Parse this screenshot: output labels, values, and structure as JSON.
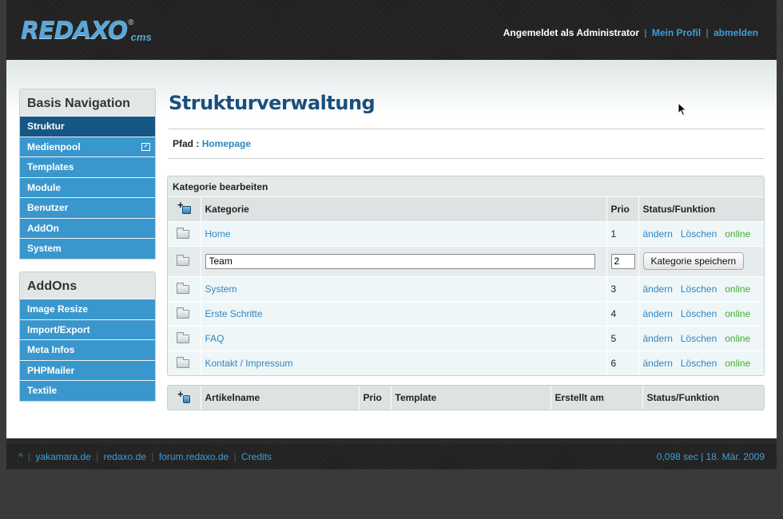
{
  "header": {
    "logo_text": "REDAXO",
    "logo_reg": "®",
    "logo_suffix": "cms",
    "logged_in_text": "Angemeldet als Administrator",
    "separator": "|",
    "profile_link": "Mein Profil",
    "logout_link": "abmelden"
  },
  "sidebar": {
    "basis": {
      "title": "Basis Navigation",
      "items": [
        {
          "label": "Struktur",
          "active": true
        },
        {
          "label": "Medienpool",
          "popup": true
        },
        {
          "label": "Templates"
        },
        {
          "label": "Module"
        },
        {
          "label": "Benutzer"
        },
        {
          "label": "AddOn"
        },
        {
          "label": "System"
        }
      ]
    },
    "addons": {
      "title": "AddOns",
      "items": [
        {
          "label": "Image Resize"
        },
        {
          "label": "Import/Export"
        },
        {
          "label": "Meta Infos"
        },
        {
          "label": "PHPMailer"
        },
        {
          "label": "Textile"
        }
      ]
    }
  },
  "main": {
    "title": "Strukturverwaltung",
    "breadcrumb_label": "Pfad :",
    "breadcrumb_link": "Homepage",
    "categories_panel": {
      "title": "Kategorie bearbeiten",
      "columns": [
        "Kategorie",
        "Prio",
        "Status/Funktion"
      ],
      "edit_label": "ändern",
      "delete_label": "Löschen",
      "online_label": "online",
      "rows": [
        {
          "name": "Home",
          "prio": "1"
        },
        {
          "editing": true,
          "name": "Team",
          "prio": "2",
          "save_label": "Kategorie speichern"
        },
        {
          "name": "System",
          "prio": "3"
        },
        {
          "name": "Erste Schritte",
          "prio": "4"
        },
        {
          "name": "FAQ",
          "prio": "5"
        },
        {
          "name": "Kontakt / Impressum",
          "prio": "6"
        }
      ]
    },
    "articles_panel": {
      "columns": [
        "Artikelname",
        "Prio",
        "Template",
        "Erstellt am",
        "Status/Funktion"
      ]
    }
  },
  "footer": {
    "top_link": "^",
    "links": [
      "yakamara.de",
      "redaxo.de",
      "forum.redaxo.de",
      "Credits"
    ],
    "separator": "|",
    "info": "0,098 sec | 18. Mär. 2009"
  },
  "colors": {
    "accent": "#3a97cd",
    "accent_dark": "#165685",
    "online": "#3fae2f",
    "link": "#2f86c0"
  }
}
